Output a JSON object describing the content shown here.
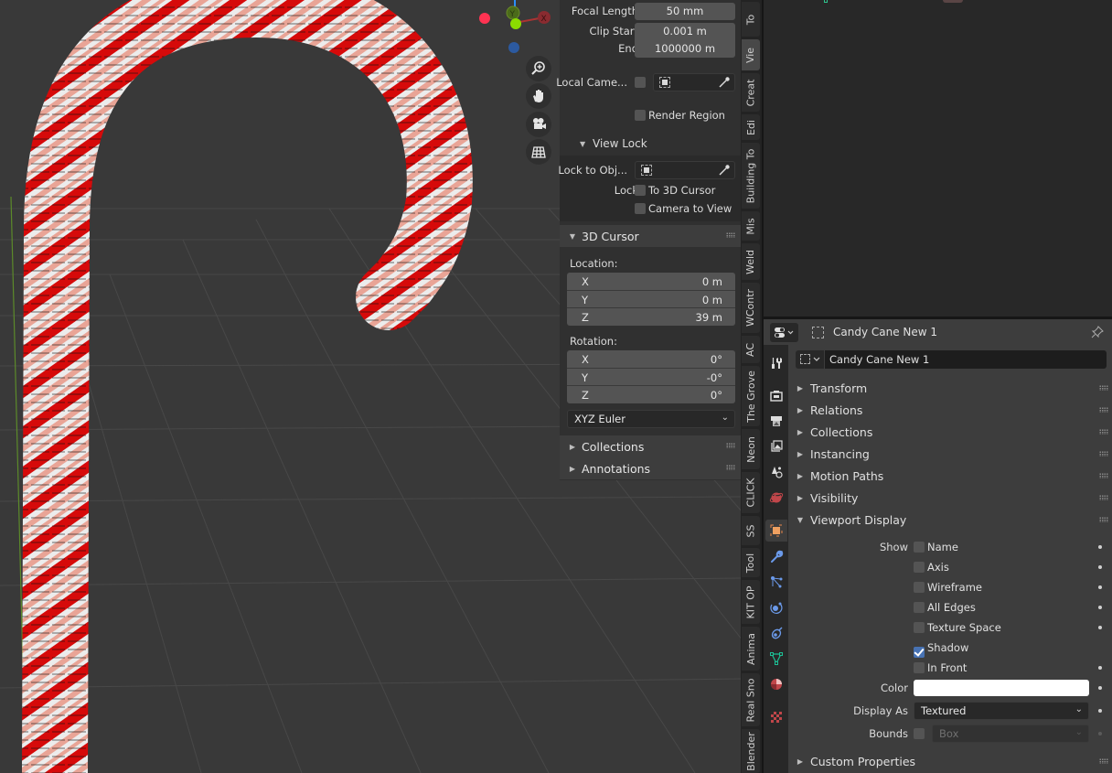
{
  "viewport": {
    "gizmo": {
      "x_label": "X",
      "y_label": "Y"
    },
    "nav_buttons": [
      {
        "name": "zoom",
        "icon": "zoom-in-icon"
      },
      {
        "name": "pan",
        "icon": "hand-icon"
      },
      {
        "name": "camera",
        "icon": "camera-icon"
      },
      {
        "name": "ortho",
        "icon": "grid-icon"
      }
    ],
    "colors": {
      "x_axis": "#ff3352",
      "y_axis": "#8bdc00",
      "z_axis": "#2c8fff",
      "cane_red": "#d60a0a",
      "cane_white": "#e8e8e8",
      "cane_pink": "#e9a496"
    }
  },
  "npanel": {
    "view": {
      "focal_length_label": "Focal Length",
      "focal_length": "50 mm",
      "clip_start_label": "Clip Start",
      "clip_start": "0.001 m",
      "clip_end_label": "End",
      "clip_end": "1000000 m",
      "local_camera_label": "Local Came...",
      "render_region_label": "Render Region"
    },
    "view_lock": {
      "title": "View Lock",
      "lock_to_object_label": "Lock to Obj...",
      "lock_label": "Lock",
      "to_3d_cursor": "To 3D Cursor",
      "camera_to_view": "Camera to View"
    },
    "cursor": {
      "title": "3D Cursor",
      "location_label": "Location:",
      "location": [
        {
          "axis": "X",
          "value": "0 m"
        },
        {
          "axis": "Y",
          "value": "0 m"
        },
        {
          "axis": "Z",
          "value": "39 m"
        }
      ],
      "rotation_label": "Rotation:",
      "rotation": [
        {
          "axis": "X",
          "value": "0°"
        },
        {
          "axis": "Y",
          "value": "-0°"
        },
        {
          "axis": "Z",
          "value": "0°"
        }
      ],
      "rotation_mode": "XYZ Euler"
    },
    "collapsed_panels": [
      "Collections",
      "Annotations"
    ]
  },
  "tabs": [
    {
      "label": "To",
      "active": false
    },
    {
      "label": "Vie",
      "active": true
    },
    {
      "label": "Creat",
      "active": false
    },
    {
      "label": "Edi",
      "active": false
    },
    {
      "label": "Building To",
      "active": false
    },
    {
      "label": "Mis",
      "active": false
    },
    {
      "label": "Weld",
      "active": false
    },
    {
      "label": "WContr",
      "active": false
    },
    {
      "label": "AC",
      "active": false
    },
    {
      "label": "The Grove",
      "active": false
    },
    {
      "label": "Neon",
      "active": false
    },
    {
      "label": "CLICK",
      "active": false
    },
    {
      "label": "SS",
      "active": false
    },
    {
      "label": "Tool",
      "active": false
    },
    {
      "label": "KIT OP",
      "active": false
    },
    {
      "label": "Anima",
      "active": false
    },
    {
      "label": "Real Sno",
      "active": false
    },
    {
      "label": "Blender",
      "active": false
    }
  ],
  "properties": {
    "header_object": "Candy Cane New 1",
    "object_name": "Candy Cane New 1",
    "side_icons": [
      "tool-icon",
      "render-icon",
      "output-icon",
      "view-layer-icon",
      "scene-icon",
      "world-icon",
      "object-icon",
      "modifier-icon",
      "particles-icon",
      "physics-icon",
      "constraints-icon",
      "data-icon",
      "material-icon",
      "texture-icon"
    ],
    "panels": [
      "Transform",
      "Relations",
      "Collections",
      "Instancing",
      "Motion Paths",
      "Visibility"
    ],
    "viewport_display": {
      "title": "Viewport Display",
      "show_label": "Show",
      "show_options": [
        {
          "label": "Name",
          "checked": false
        },
        {
          "label": "Axis",
          "checked": false
        },
        {
          "label": "Wireframe",
          "checked": false
        },
        {
          "label": "All Edges",
          "checked": false
        },
        {
          "label": "Texture Space",
          "checked": false
        },
        {
          "label": "Shadow",
          "checked": true
        },
        {
          "label": "In Front",
          "checked": false
        }
      ],
      "color_label": "Color",
      "color_value": "#ffffff",
      "display_as_label": "Display As",
      "display_as": "Textured",
      "bounds_label": "Bounds",
      "bounds_checked": false,
      "bounds_type": "Box"
    },
    "custom_properties": "Custom Properties"
  }
}
